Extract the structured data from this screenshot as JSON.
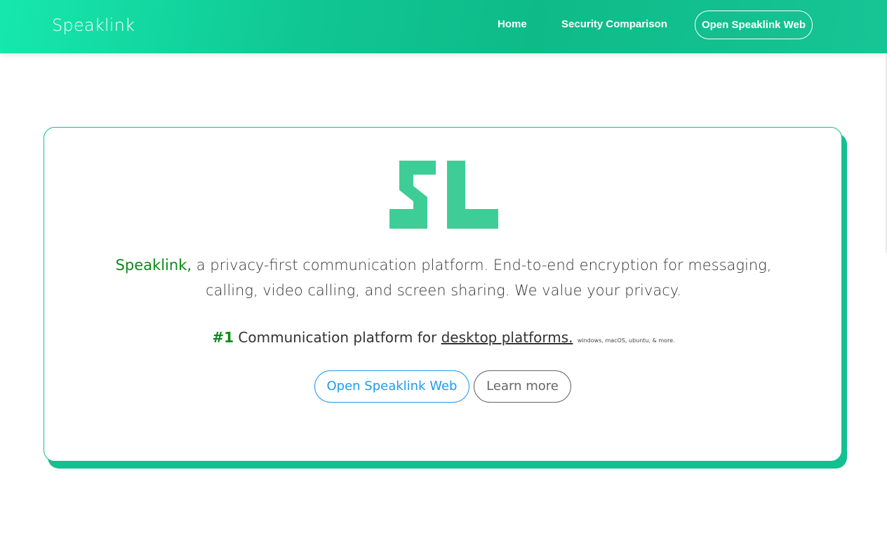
{
  "header": {
    "brand": "Speaklink",
    "nav": {
      "home": "Home",
      "security": "Security Comparison",
      "open_web": "Open Speaklink Web"
    }
  },
  "hero": {
    "logo_text": "SL",
    "brand_highlight": "Speaklink,",
    "tagline": " a privacy-first communication platform. End-to-end encryption for messaging, calling, video calling, and screen sharing. We value your privacy.",
    "rank": "#1",
    "rank_text": " Communication platform for ",
    "platforms_link": "desktop platforms.",
    "platforms_note": "windows, macOS, ubuntu, & more.",
    "primary_button": "Open Speaklink Web",
    "secondary_button": "Learn more"
  },
  "colors": {
    "brand_green": "#13c08f",
    "logo_green": "#3ecd97",
    "accent_dark_green": "#0c8a1a",
    "link_blue": "#1e9bf0"
  }
}
